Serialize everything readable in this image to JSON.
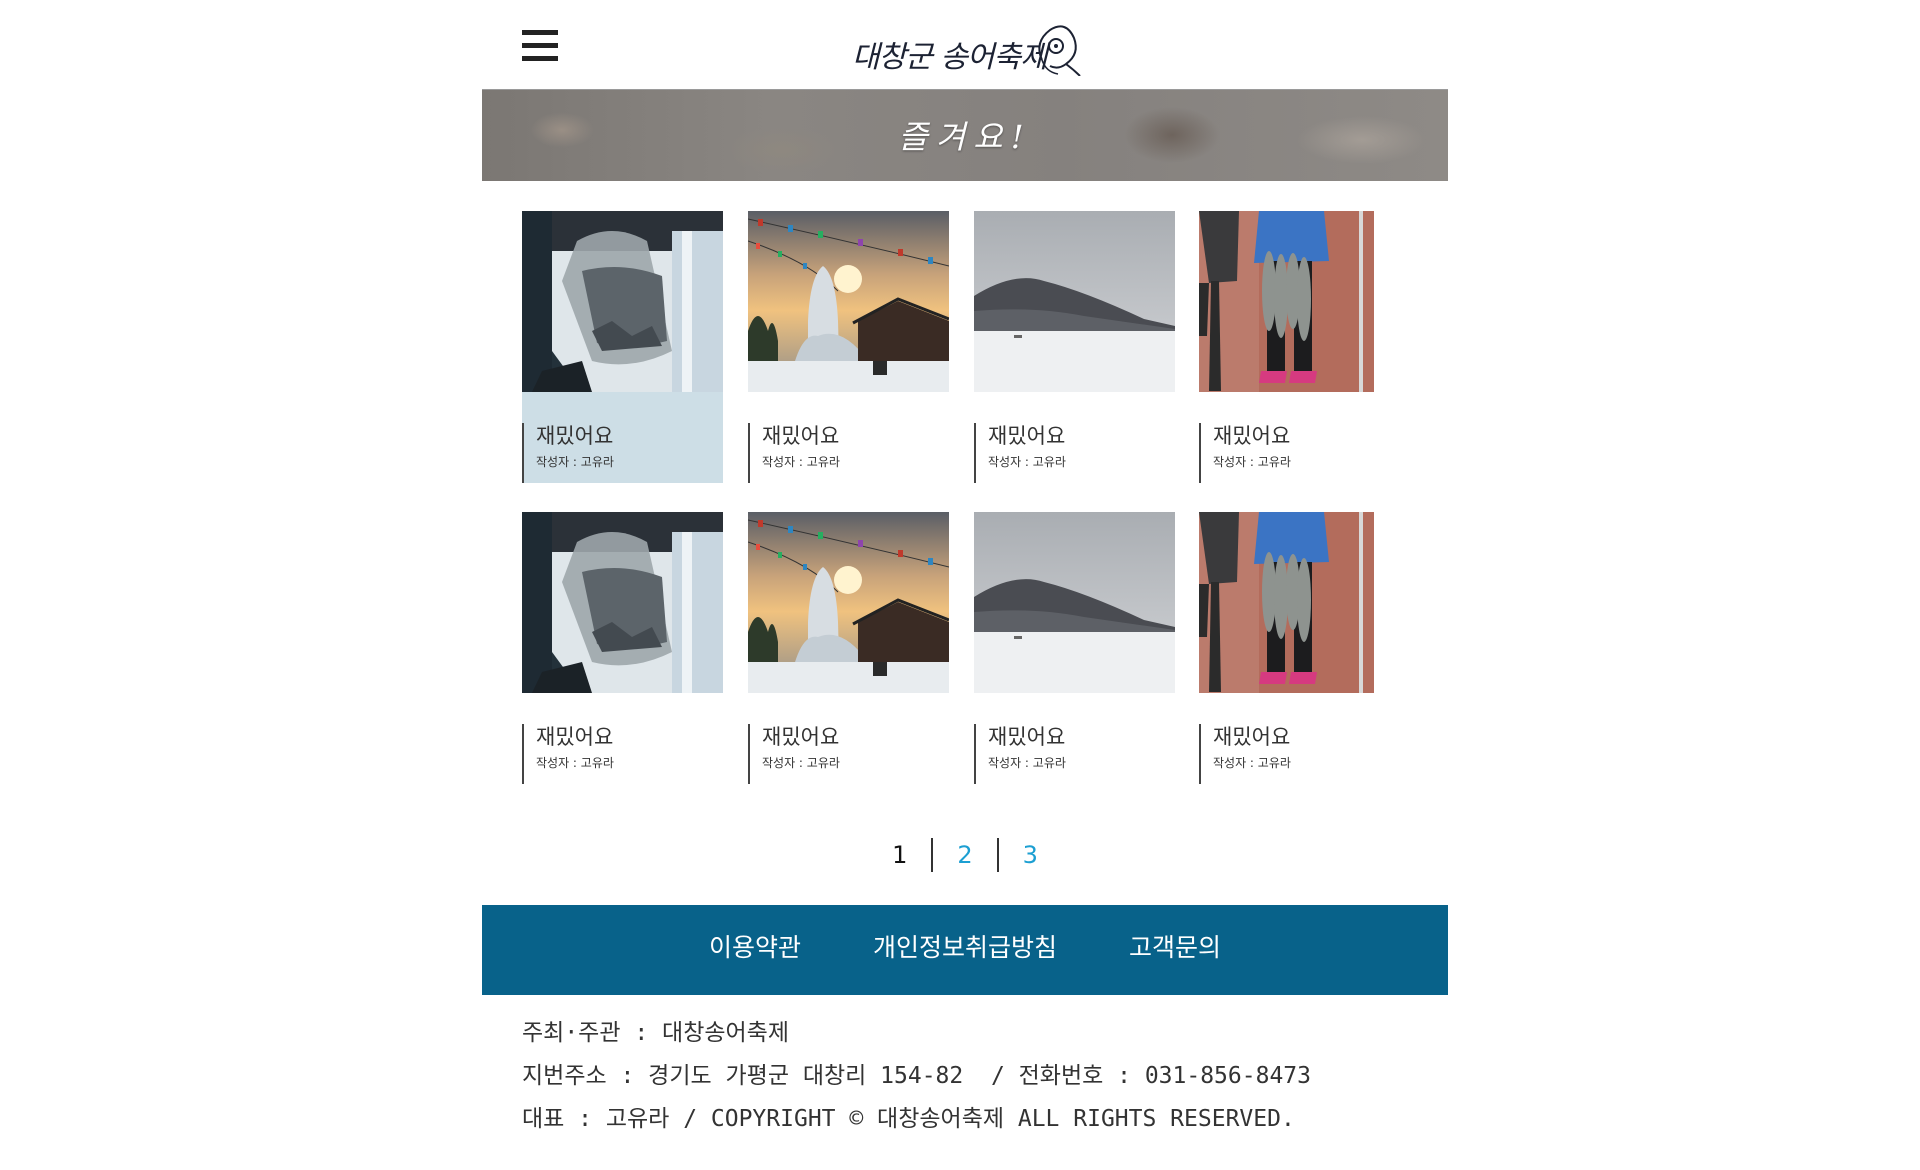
{
  "header": {
    "menu_icon": "hamburger-menu-icon",
    "logo_text": "대창군 송어축제",
    "logo_icon": "fish-icon"
  },
  "banner": {
    "title": "즐겨요!"
  },
  "gallery": {
    "items": [
      {
        "title": "재밌어요",
        "author": "작성자 : 고유라",
        "image": "bag-of-fish-photo"
      },
      {
        "title": "재밌어요",
        "author": "작성자 : 고유라",
        "image": "ice-sculpture-sunset-photo"
      },
      {
        "title": "재밌어요",
        "author": "작성자 : 고유라",
        "image": "frozen-lake-photo"
      },
      {
        "title": "재밌어요",
        "author": "작성자 : 고유라",
        "image": "fish-catch-photo"
      },
      {
        "title": "재밌어요",
        "author": "작성자 : 고유라",
        "image": "bag-of-fish-photo"
      },
      {
        "title": "재밌어요",
        "author": "작성자 : 고유라",
        "image": "ice-sculpture-sunset-photo"
      },
      {
        "title": "재밌어요",
        "author": "작성자 : 고유라",
        "image": "frozen-lake-photo"
      },
      {
        "title": "재밌어요",
        "author": "작성자 : 고유라",
        "image": "fish-catch-photo"
      }
    ]
  },
  "pagination": {
    "pages": [
      "1",
      "2",
      "3"
    ],
    "current": "1"
  },
  "footer": {
    "nav": [
      "이용약관",
      "개인정보취급방침",
      "고객문의"
    ],
    "info_line1": "주최·주관 : 대창송어축제",
    "info_line2": "지번주소 : 경기도 가평군 대창리 154-82  / 전화번호 : 031-856-8473",
    "info_line3": "대표 : 고유라 / COPYRIGHT © 대창송어축제 ALL RIGHTS RESERVED."
  },
  "colors": {
    "accent_blue": "#08628a",
    "link_blue": "#1c9fd2",
    "active_card": "#cddee6"
  }
}
